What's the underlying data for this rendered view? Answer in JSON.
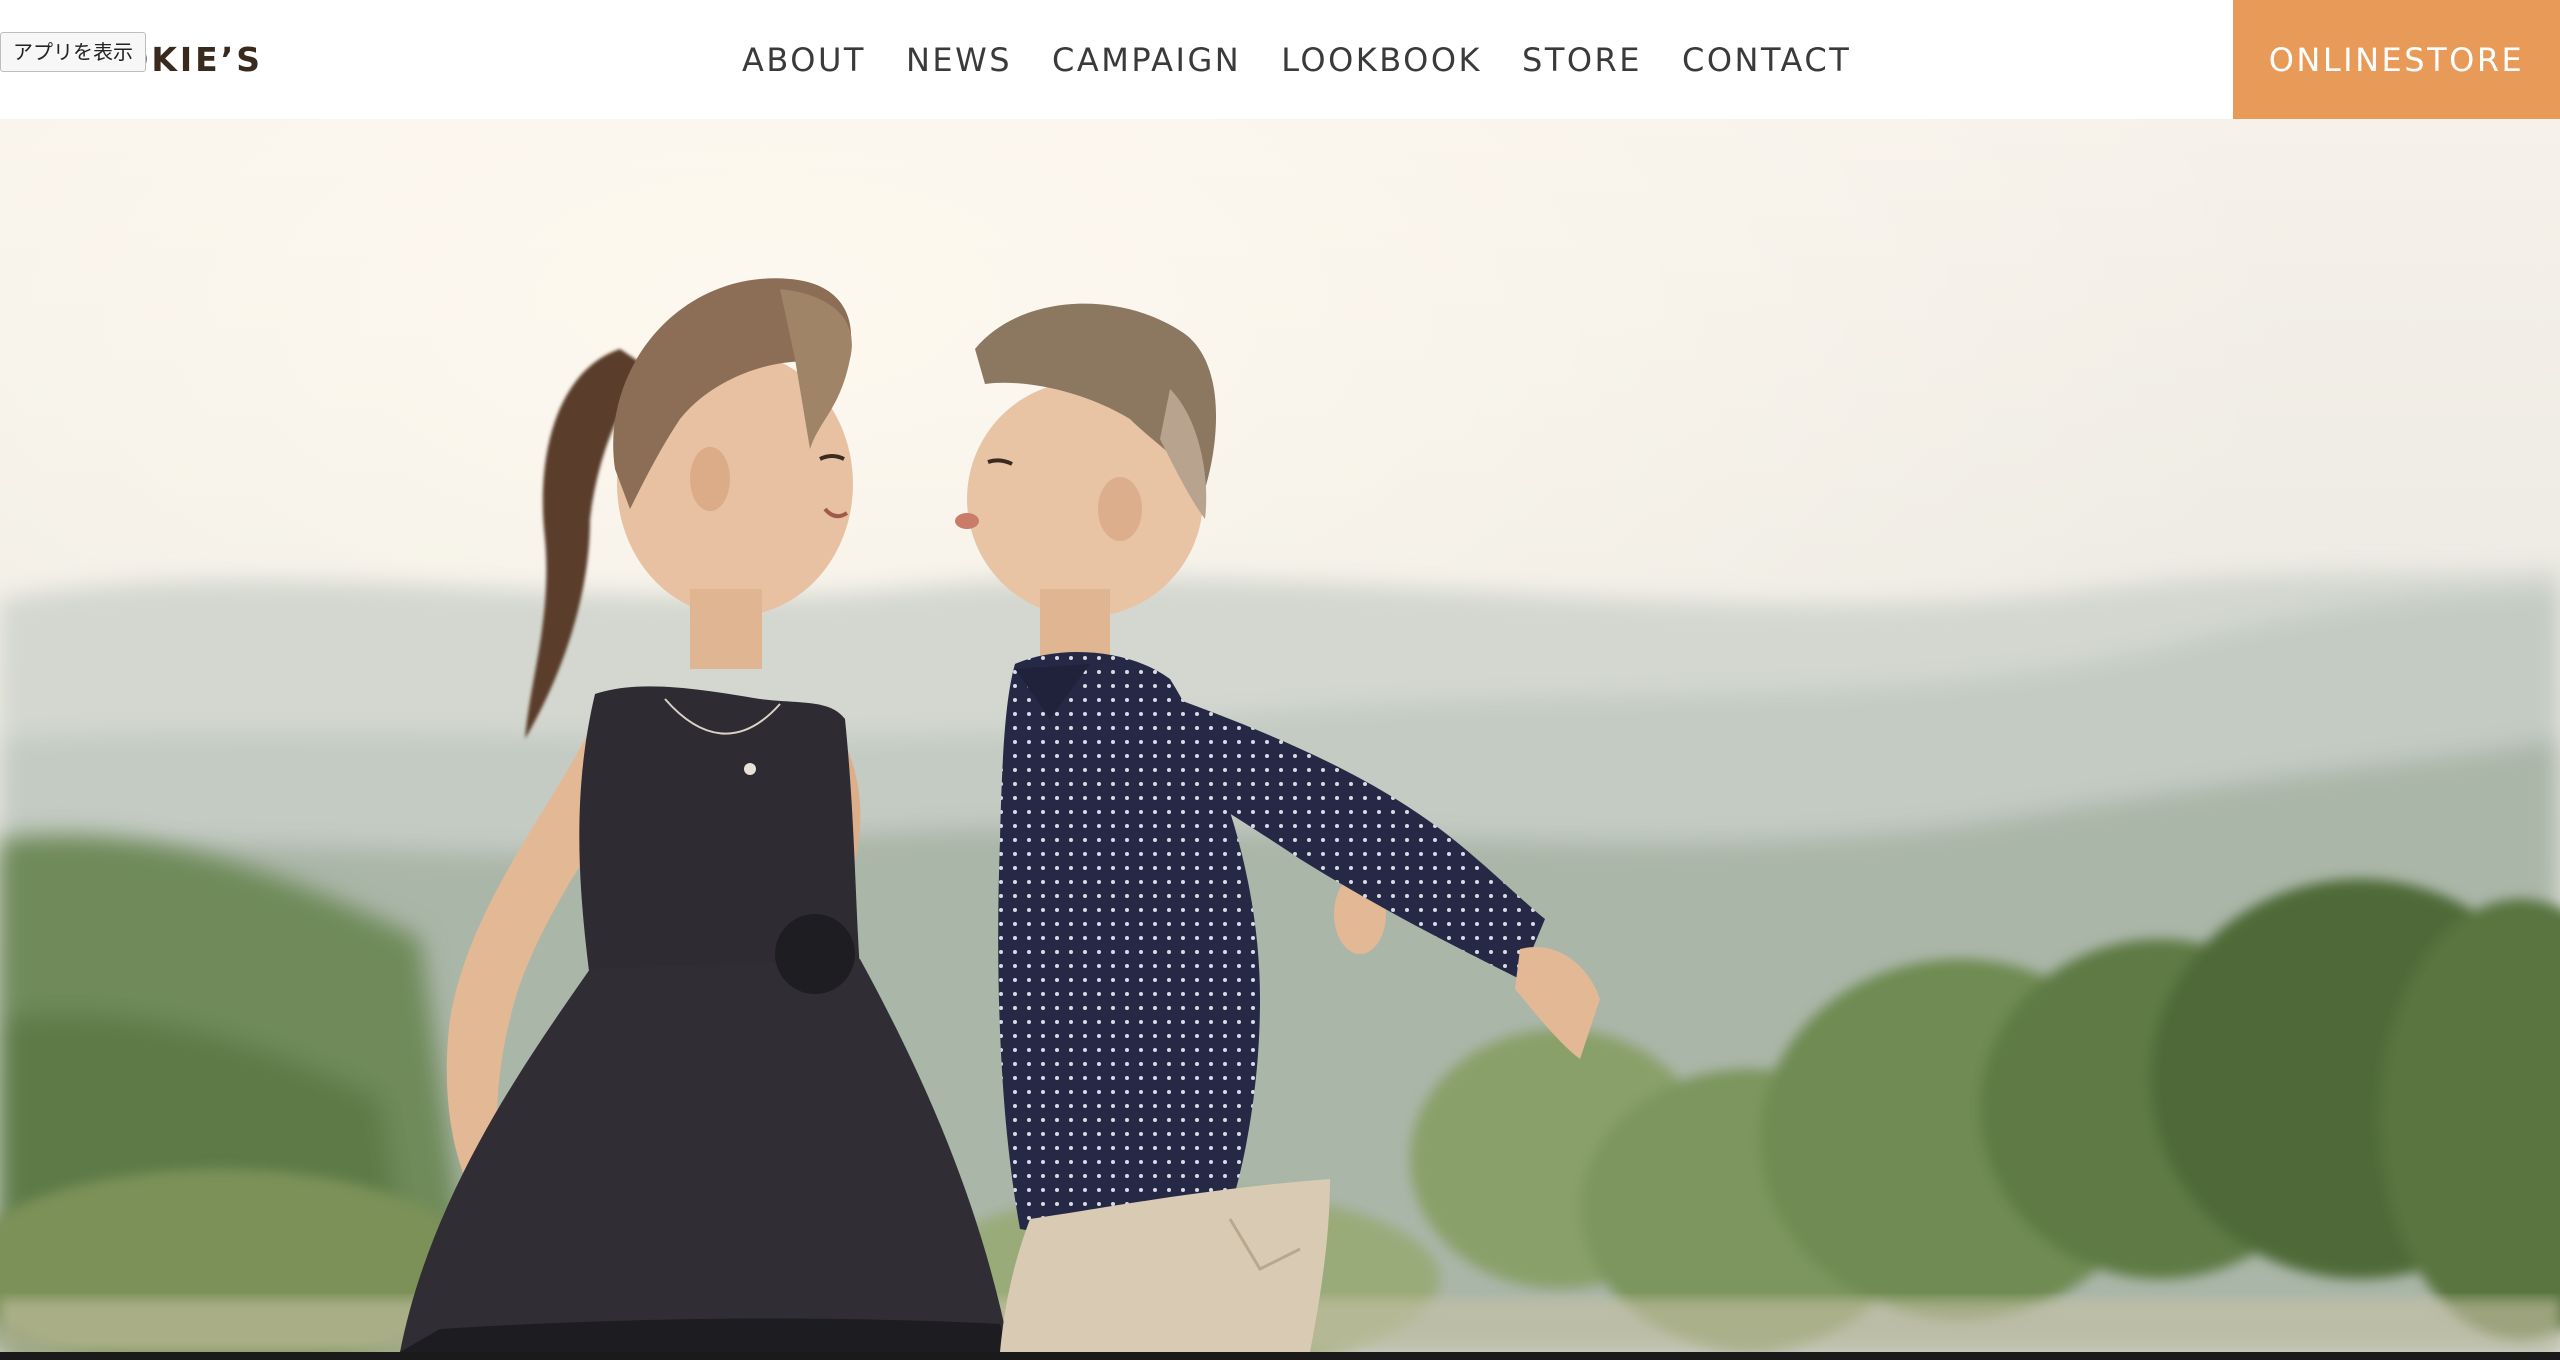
{
  "header": {
    "logo": "COOKIE’S",
    "tooltip": "アプリを表示",
    "nav": [
      "ABOUT",
      "NEWS",
      "CAMPAIGN",
      "LOOKBOOK",
      "STORE",
      "CONTACT"
    ],
    "store_button": "ONLINESTORE"
  },
  "hero": {
    "image": "photo-girl-and-boy-kissing-outdoors",
    "colors": {
      "sky": "#f2ede6",
      "hills": "#b9c3b9",
      "trees": "#7f9a5e",
      "dress": "#2c2a30",
      "shirt": "#2b2d4a",
      "pants": "#d9cbb3"
    }
  },
  "colors": {
    "accent": "#e89a58",
    "nav_text": "#3a3a3a",
    "logo_text": "#3a2a1e"
  }
}
